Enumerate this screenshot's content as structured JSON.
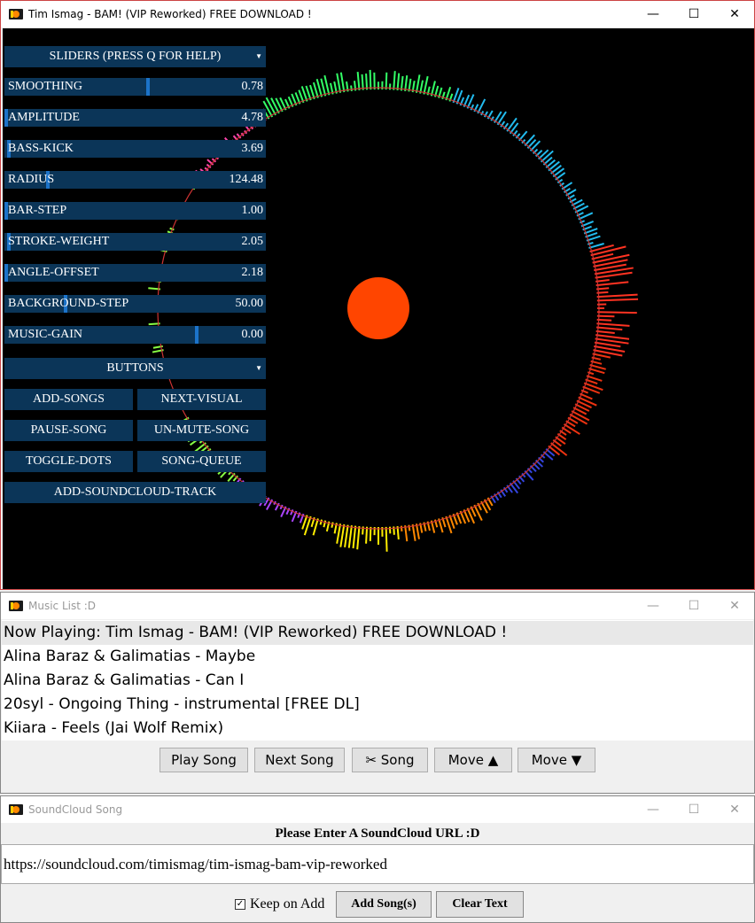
{
  "viz_window": {
    "title": "Tim Ismag - BAM! (VIP Reworked) FREE DOWNLOAD !",
    "controls": {
      "minimize": "—",
      "maximize": "☐",
      "close": "✕"
    },
    "sliders_header": "SLIDERS (PRESS Q FOR HELP)",
    "sliders": [
      {
        "label": "SMOOTHING",
        "value": "0.78",
        "knob_fraction": 0.55
      },
      {
        "label": "AMPLITUDE",
        "value": "4.78",
        "knob_fraction": 0.0
      },
      {
        "label": "BASS-KICK",
        "value": "3.69",
        "knob_fraction": 0.01
      },
      {
        "label": "RADIUS",
        "value": "124.48",
        "knob_fraction": 0.16
      },
      {
        "label": "BAR-STEP",
        "value": "1.00",
        "knob_fraction": 0.0
      },
      {
        "label": "STROKE-WEIGHT",
        "value": "2.05",
        "knob_fraction": 0.01
      },
      {
        "label": "ANGLE-OFFSET",
        "value": "2.18",
        "knob_fraction": 0.0
      },
      {
        "label": "BACKGROUND-STEP",
        "value": "50.00",
        "knob_fraction": 0.23
      },
      {
        "label": "MUSIC-GAIN",
        "value": "0.00",
        "knob_fraction": 0.74
      }
    ],
    "buttons_header": "BUTTONS",
    "buttons": {
      "add_songs": "ADD-SONGS",
      "next_visual": "NEXT-VISUAL",
      "pause_song": "PAUSE-SONG",
      "unmute_song": "UN-MUTE-SONG",
      "toggle_dots": "TOGGLE-DOTS",
      "song_queue": "SONG-QUEUE",
      "add_soundcloud": "ADD-SOUNDCLOUD-TRACK"
    },
    "colors": {
      "accent_orange": "#ff4500",
      "panel_blue": "#0b3558",
      "knob_blue": "#1c73c9"
    }
  },
  "music_window": {
    "title": "Music List :D",
    "controls": {
      "minimize": "—",
      "maximize": "☐",
      "close": "✕"
    },
    "songs": [
      "Now Playing: Tim Ismag - BAM! (VIP Reworked) FREE DOWNLOAD !",
      "Alina Baraz & Galimatias - Maybe",
      "Alina Baraz & Galimatias - Can I",
      "20syl - Ongoing Thing - instrumental [FREE DL]",
      "Kiiara - Feels (Jai Wolf Remix)"
    ],
    "buttons": {
      "play": "Play Song",
      "next": "Next Song",
      "cut": "✂ Song",
      "move_up": "Move ▲",
      "move_down": "Move ▼"
    }
  },
  "soundcloud_window": {
    "title": "SoundCloud Song",
    "controls": {
      "minimize": "—",
      "maximize": "☐",
      "close": "✕"
    },
    "heading": "Please Enter A SoundCloud URL :D",
    "url_value": "https://soundcloud.com/timismag/tim-ismag-bam-vip-reworked",
    "keep_checked": true,
    "keep_label": "Keep on Add",
    "add_button": "Add Song(s)",
    "clear_button": "Clear Text"
  }
}
